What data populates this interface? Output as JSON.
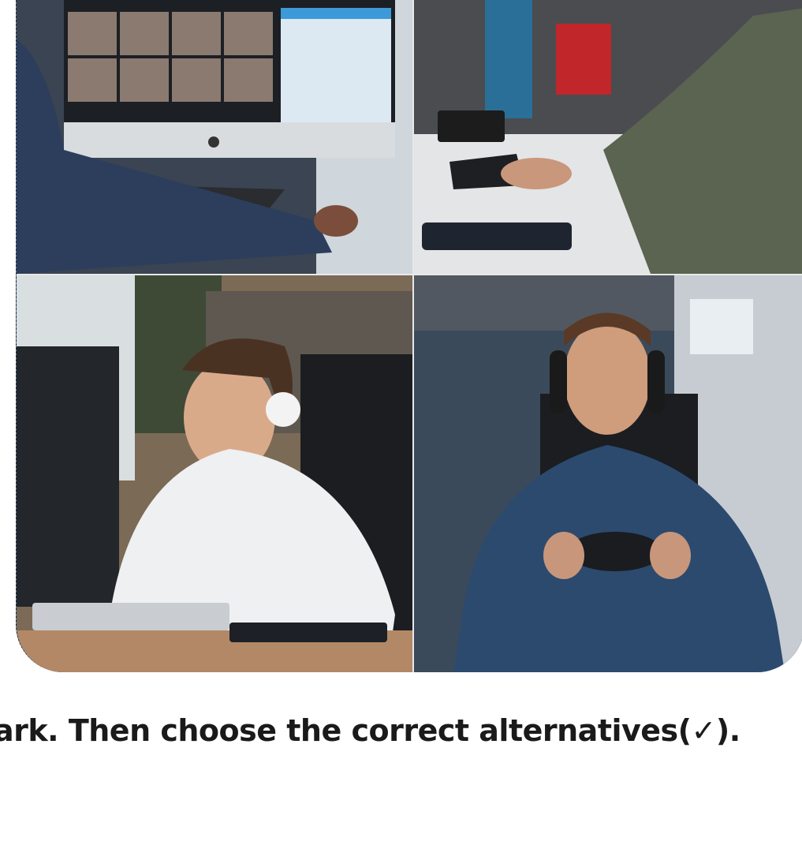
{
  "photos": [
    {
      "name": "video-call-workstation-photo"
    },
    {
      "name": "typing-at-desk-photo"
    },
    {
      "name": "woman-with-headphones-photo"
    },
    {
      "name": "man-with-game-controller-photo"
    }
  ],
  "instruction": {
    "text": "ark. Then choose the correct alternatives(✓)."
  }
}
